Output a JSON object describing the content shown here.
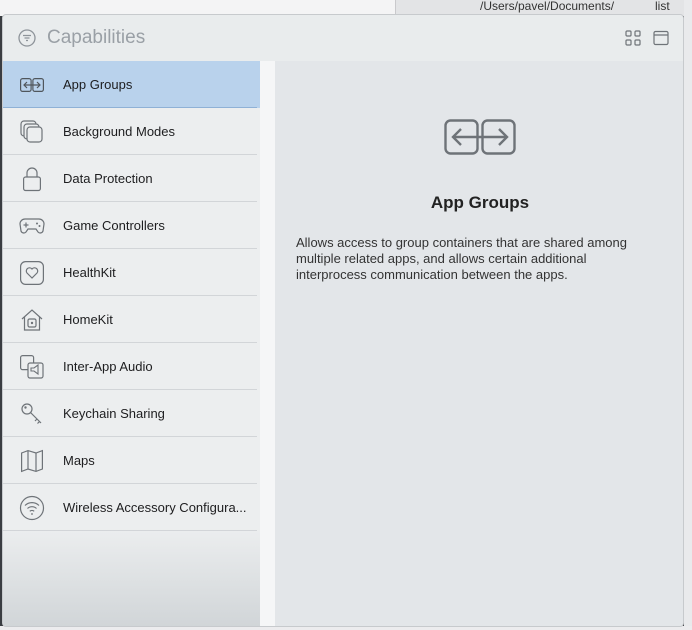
{
  "background": {
    "path_text": "/Users/pavel/Documents/",
    "right_text": "list"
  },
  "titlebar": {
    "title": "Capabilities",
    "icons": {
      "filter": "filter-icon",
      "grid": "grid-view-icon",
      "panel": "panel-view-icon"
    }
  },
  "sidebar": {
    "items": [
      {
        "label": "App Groups",
        "icon": "app-groups-icon",
        "selected": true
      },
      {
        "label": "Background Modes",
        "icon": "background-modes-icon"
      },
      {
        "label": "Data Protection",
        "icon": "lock-icon"
      },
      {
        "label": "Game Controllers",
        "icon": "gamepad-icon"
      },
      {
        "label": "HealthKit",
        "icon": "heart-icon"
      },
      {
        "label": "HomeKit",
        "icon": "home-icon"
      },
      {
        "label": "Inter-App Audio",
        "icon": "audio-icon"
      },
      {
        "label": "Keychain Sharing",
        "icon": "key-icon"
      },
      {
        "label": "Maps",
        "icon": "map-icon"
      },
      {
        "label": "Wireless Accessory Configura...",
        "icon": "wireless-icon"
      }
    ]
  },
  "detail": {
    "title": "App Groups",
    "description": "Allows access to group containers that are shared among multiple related apps, and allows certain additional interprocess communication between the apps."
  },
  "colors": {
    "selection": "#b9d2ec",
    "icon_gray": "#6e7378"
  }
}
